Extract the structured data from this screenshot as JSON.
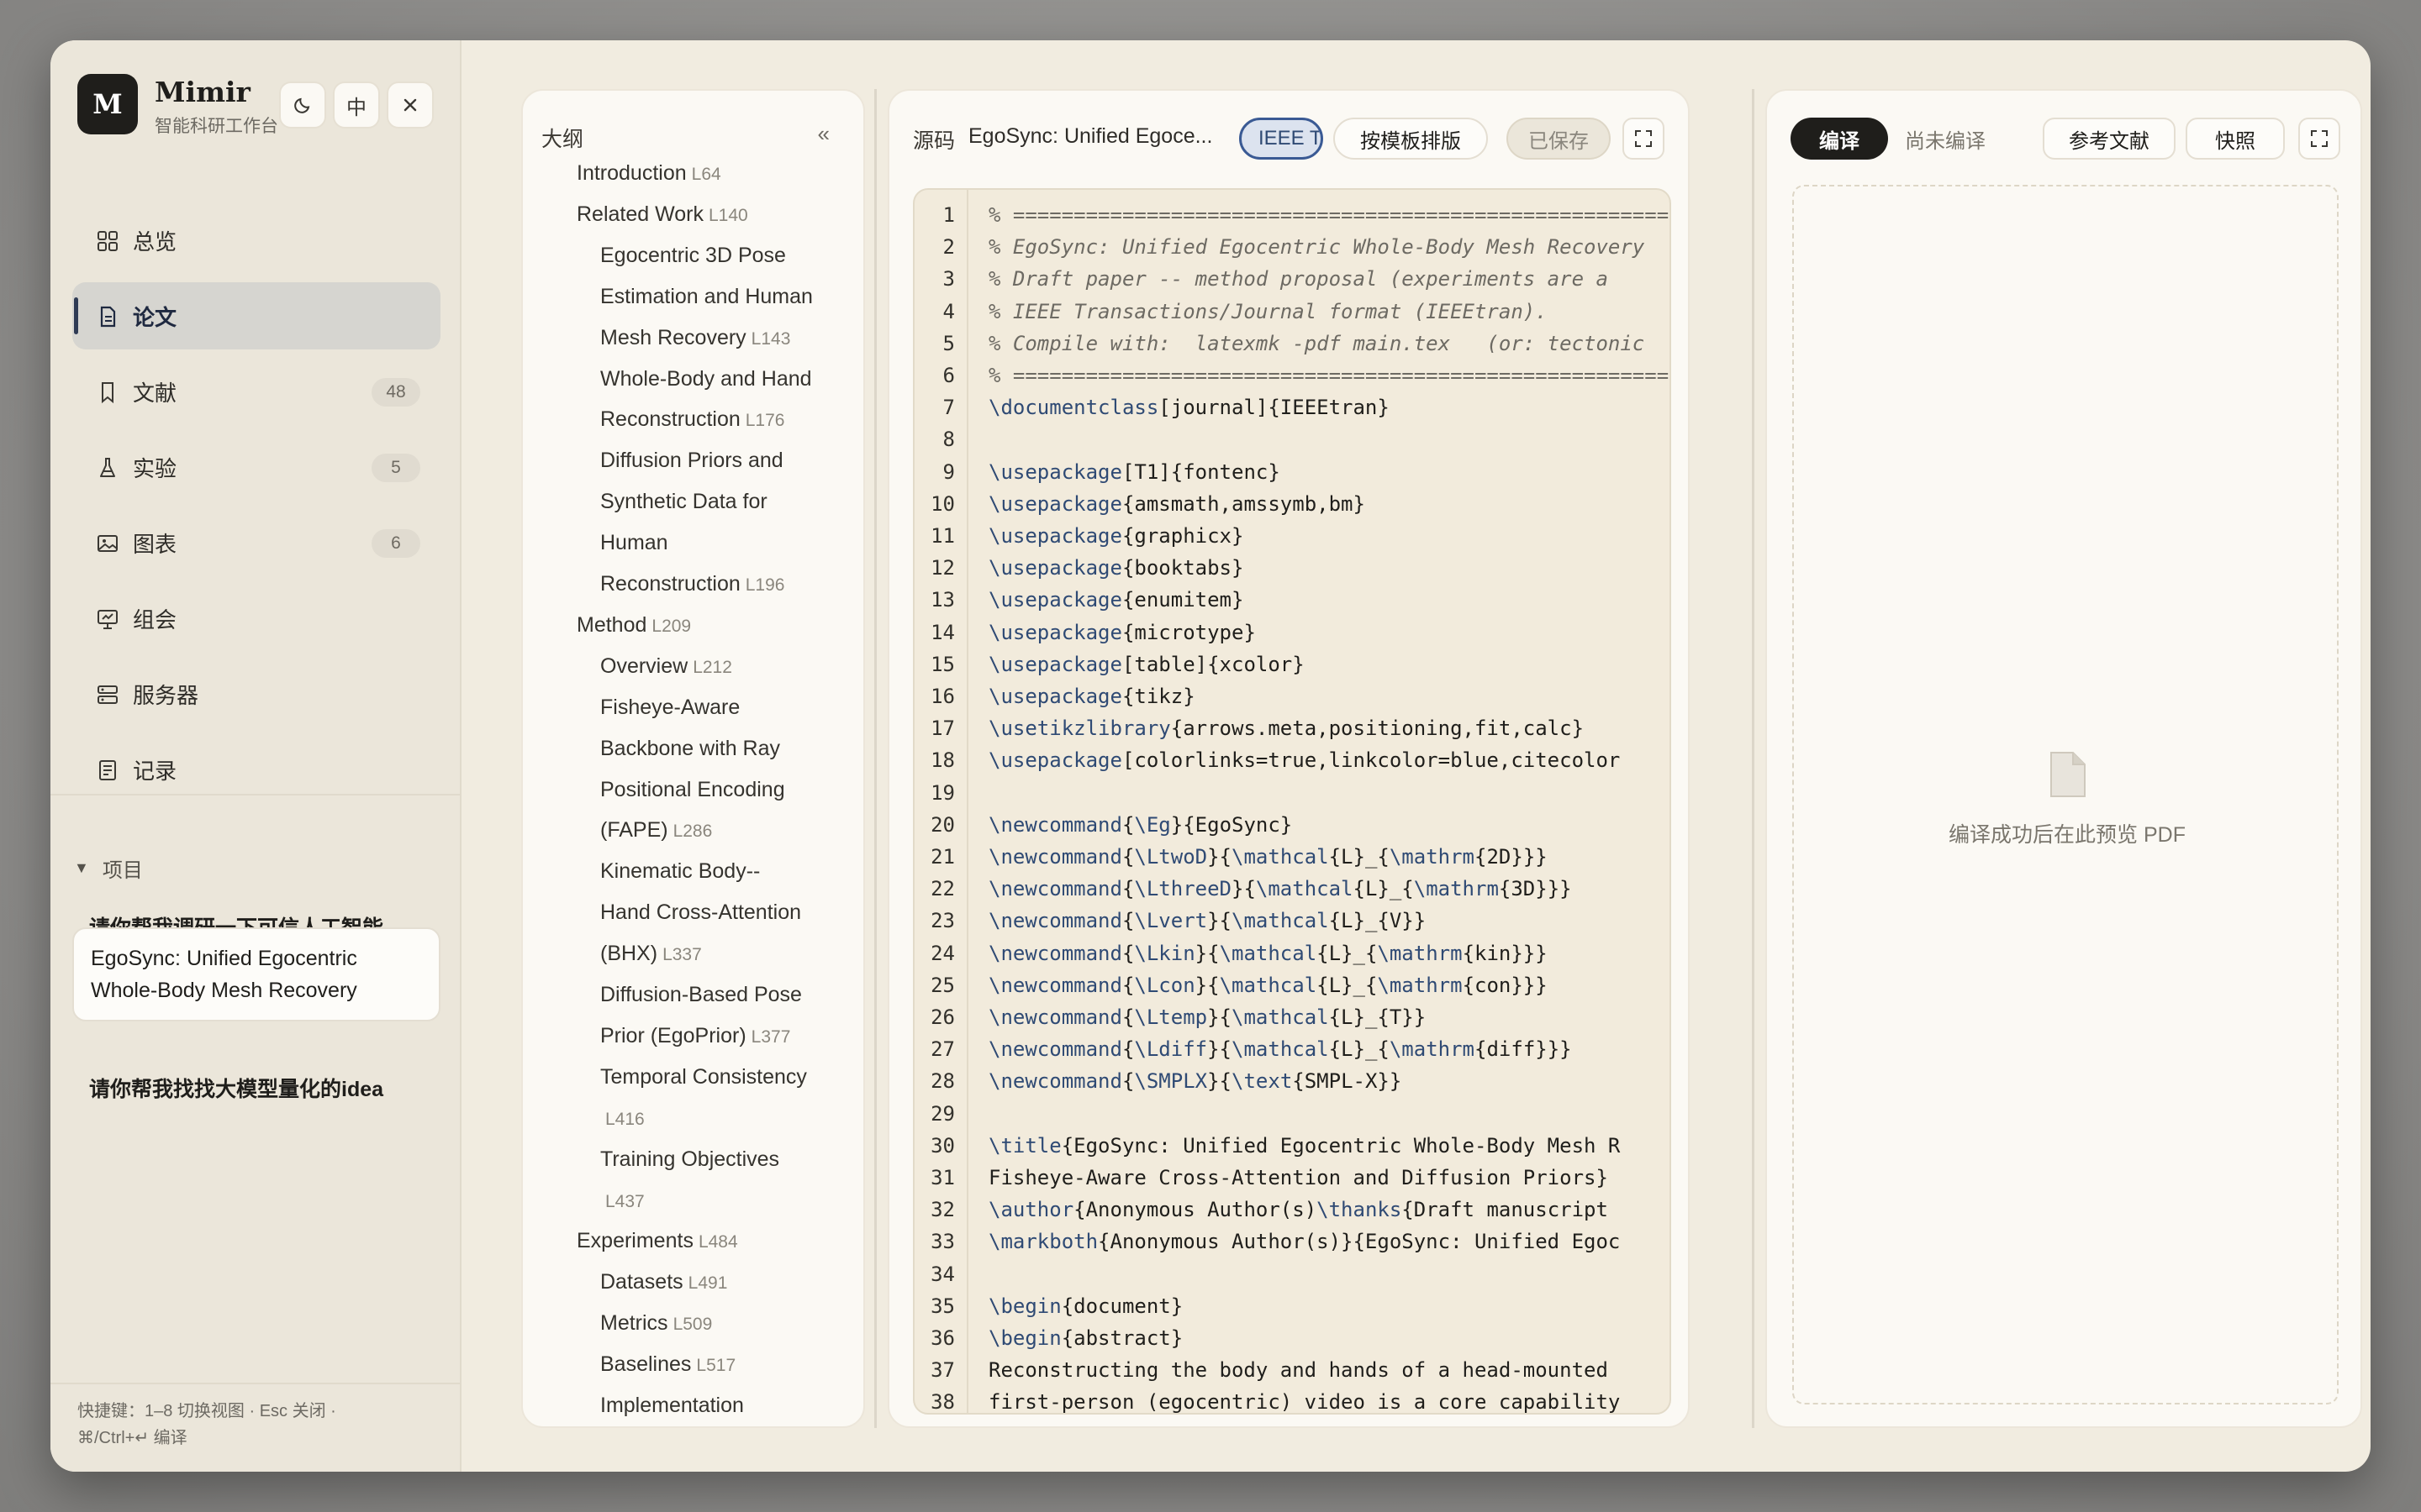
{
  "app": {
    "name": "Mimir",
    "subtitle": "智能科研工作台",
    "logo_letter": "M"
  },
  "top_controls": {
    "theme_icon": "moon-icon",
    "lang": "中",
    "close_icon": "close-icon"
  },
  "nav": [
    {
      "label": "总览",
      "icon": "grid-icon"
    },
    {
      "label": "论文",
      "icon": "document-icon",
      "active": true
    },
    {
      "label": "文献",
      "icon": "bookmark-icon",
      "badge": "48"
    },
    {
      "label": "实验",
      "icon": "flask-icon",
      "badge": "5"
    },
    {
      "label": "图表",
      "icon": "image-icon",
      "badge": "6"
    },
    {
      "label": "组会",
      "icon": "presentation-icon"
    },
    {
      "label": "服务器",
      "icon": "server-icon"
    },
    {
      "label": "记录",
      "icon": "notes-icon"
    }
  ],
  "projects": {
    "header": "项目",
    "items": [
      {
        "title": "请你帮我调研一下可信人工智能"
      },
      {
        "title": "EgoSync: Unified Egocentric Whole-Body Mesh Recovery",
        "active": true
      },
      {
        "title": "请你帮我找找大模型量化的idea"
      }
    ]
  },
  "shortcuts": {
    "line1": "快捷键：1–8 切换视图 · Esc 关闭 ·",
    "line2": "⌘/Ctrl+↵ 编译"
  },
  "outline": {
    "title": "大纲",
    "collapse_icon": "«",
    "items": [
      {
        "text": "Introduction",
        "line": "L64",
        "level": 1
      },
      {
        "text": "Related Work",
        "line": "L140",
        "level": 1
      },
      {
        "text": "Egocentric 3D Pose",
        "level": 2
      },
      {
        "text": "Estimation and Human",
        "level": 2
      },
      {
        "text": "Mesh Recovery",
        "line": "L143",
        "level": 2
      },
      {
        "text": "Whole-Body and Hand",
        "level": 2
      },
      {
        "text": "Reconstruction",
        "line": "L176",
        "level": 2
      },
      {
        "text": "Diffusion Priors and",
        "level": 2
      },
      {
        "text": "Synthetic Data for",
        "level": 2
      },
      {
        "text": "Human",
        "level": 2
      },
      {
        "text": "Reconstruction",
        "line": "L196",
        "level": 2
      },
      {
        "text": "Method",
        "line": "L209",
        "level": 1
      },
      {
        "text": "Overview",
        "line": "L212",
        "level": 2
      },
      {
        "text": "Fisheye-Aware",
        "level": 2
      },
      {
        "text": "Backbone with Ray",
        "level": 2
      },
      {
        "text": "Positional Encoding",
        "level": 2
      },
      {
        "text": "(FAPE)",
        "line": "L286",
        "level": 2
      },
      {
        "text": "Kinematic Body--",
        "level": 2
      },
      {
        "text": "Hand Cross-Attention",
        "level": 2
      },
      {
        "text": "(BHX)",
        "line": "L337",
        "level": 2
      },
      {
        "text": "Diffusion-Based Pose",
        "level": 2
      },
      {
        "text": "Prior (EgoPrior)",
        "line": "L377",
        "level": 2
      },
      {
        "text": "Temporal Consistency",
        "level": 2
      },
      {
        "text": "",
        "line": "L416",
        "level": 2
      },
      {
        "text": "Training Objectives",
        "level": 2
      },
      {
        "text": "",
        "line": "L437",
        "level": 2
      },
      {
        "text": "Experiments",
        "line": "L484",
        "level": 1
      },
      {
        "text": "Datasets",
        "line": "L491",
        "level": 2
      },
      {
        "text": "Metrics",
        "line": "L509",
        "level": 2
      },
      {
        "text": "Baselines",
        "line": "L517",
        "level": 2
      },
      {
        "text": "Implementation",
        "level": 2
      }
    ]
  },
  "source": {
    "label": "源码",
    "file_title": "EgoSync: Unified Egoce...",
    "template_tag": "IEEE Tr",
    "format_button": "按模板排版",
    "saved_status": "已保存",
    "expand_icon": "expand-icon",
    "lines": [
      "% ==============================================================",
      "% EgoSync: Unified Egocentric Whole-Body Mesh Recovery",
      "% Draft paper -- method proposal (experiments are a",
      "% IEEE Transactions/Journal format (IEEEtran).",
      "% Compile with:  latexmk -pdf main.tex   (or: tectonic",
      "% ==============================================================",
      "\\documentclass[journal]{IEEEtran}",
      "",
      "\\usepackage[T1]{fontenc}",
      "\\usepackage{amsmath,amssymb,bm}",
      "\\usepackage{graphicx}",
      "\\usepackage{booktabs}",
      "\\usepackage{enumitem}",
      "\\usepackage{microtype}",
      "\\usepackage[table]{xcolor}",
      "\\usepackage{tikz}",
      "\\usetikzlibrary{arrows.meta,positioning,fit,calc}",
      "\\usepackage[colorlinks=true,linkcolor=blue,citecolor",
      "",
      "\\newcommand{\\Eg}{EgoSync}",
      "\\newcommand{\\LtwoD}{\\mathcal{L}_{\\mathrm{2D}}}",
      "\\newcommand{\\LthreeD}{\\mathcal{L}_{\\mathrm{3D}}}",
      "\\newcommand{\\Lvert}{\\mathcal{L}_{V}}",
      "\\newcommand{\\Lkin}{\\mathcal{L}_{\\mathrm{kin}}}",
      "\\newcommand{\\Lcon}{\\mathcal{L}_{\\mathrm{con}}}",
      "\\newcommand{\\Ltemp}{\\mathcal{L}_{T}}",
      "\\newcommand{\\Ldiff}{\\mathcal{L}_{\\mathrm{diff}}}",
      "\\newcommand{\\SMPLX}{\\text{SMPL-X}}",
      "",
      "\\title{EgoSync: Unified Egocentric Whole-Body Mesh R",
      "Fisheye-Aware Cross-Attention and Diffusion Priors}",
      "\\author{Anonymous Author(s)\\thanks{Draft manuscript",
      "\\markboth{Anonymous Author(s)}{EgoSync: Unified Egoc",
      "",
      "\\begin{document}",
      "\\begin{abstract}",
      "Reconstructing the body and hands of a head-mounted",
      "first-person (egocentric) video is a core capability"
    ]
  },
  "preview": {
    "compile_button": "编译",
    "status": "尚未编译",
    "refs_button": "参考文献",
    "snapshot_button": "快照",
    "expand_icon": "expand-icon",
    "placeholder": "编译成功后在此预览 PDF",
    "placeholder_icon": "file-icon"
  },
  "colors": {
    "accent_dark": "#1f1e1b",
    "active_nav": "#2f3b54",
    "tag_blue": "#3a5a94",
    "command_blue": "#2f4a74"
  }
}
